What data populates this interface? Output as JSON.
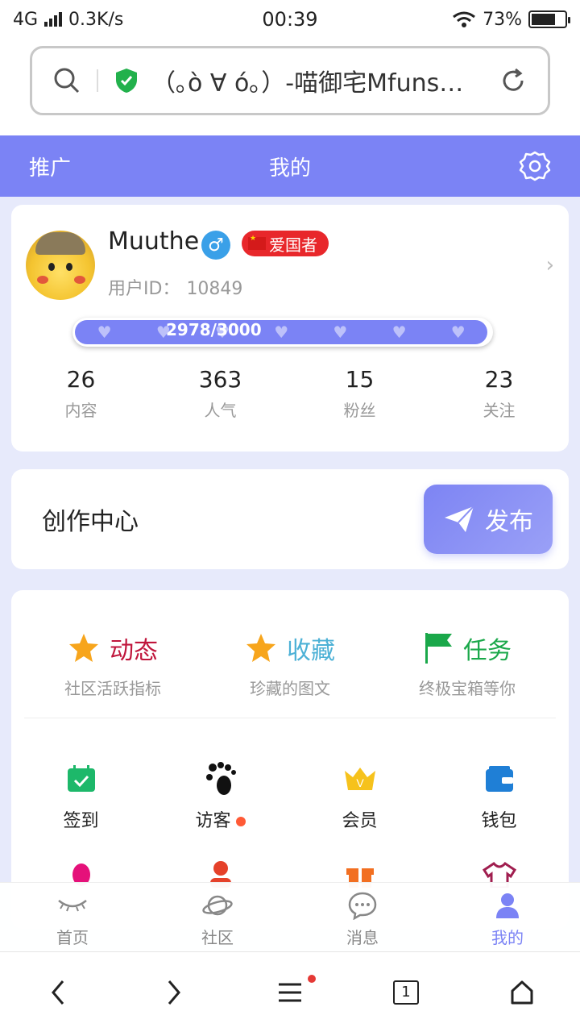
{
  "status": {
    "network": "4G",
    "speed": "0.3K/s",
    "time": "00:39",
    "battery": "73%",
    "battery_level": 0.73
  },
  "browser": {
    "url_title": "（｡ò ∀ ó｡）-喵御宅Mfuns…",
    "tabs_count": "1"
  },
  "header": {
    "left": "推广",
    "title": "我的"
  },
  "profile": {
    "username": "Muuthe",
    "gender_symbol": "♂",
    "badge": "爱国者",
    "id_label": "用户ID：",
    "id_value": "10849",
    "exp_text": "2978/3000",
    "exp_progress": 0.993,
    "stats": [
      {
        "value": "26",
        "label": "内容"
      },
      {
        "value": "363",
        "label": "人气"
      },
      {
        "value": "15",
        "label": "粉丝"
      },
      {
        "value": "23",
        "label": "关注"
      }
    ]
  },
  "creation": {
    "title": "创作中心",
    "publish_label": "发布"
  },
  "features": [
    {
      "title": "动态",
      "subtitle": "社区活跃指标",
      "icon": "star-icon",
      "color": "#c0163c"
    },
    {
      "title": "收藏",
      "subtitle": "珍藏的图文",
      "icon": "star-icon",
      "color": "#4db1d6"
    },
    {
      "title": "任务",
      "subtitle": "终极宝箱等你",
      "icon": "flag-icon",
      "color": "#1aa84a"
    }
  ],
  "grid": [
    {
      "label": "签到",
      "icon": "calendar-check-icon"
    },
    {
      "label": "访客",
      "icon": "footprints-icon",
      "dot": true
    },
    {
      "label": "会员",
      "icon": "crown-icon"
    },
    {
      "label": "钱包",
      "icon": "wallet-icon"
    }
  ],
  "tabs": [
    {
      "label": "首页",
      "icon": "closed-eye-icon"
    },
    {
      "label": "社区",
      "icon": "planet-icon"
    },
    {
      "label": "消息",
      "icon": "chat-bubble-icon"
    },
    {
      "label": "我的",
      "icon": "user-icon",
      "active": true
    }
  ],
  "colors": {
    "accent": "#7b83f5",
    "badge_red": "#e8272b",
    "gender_blue": "#3aa0e8"
  }
}
